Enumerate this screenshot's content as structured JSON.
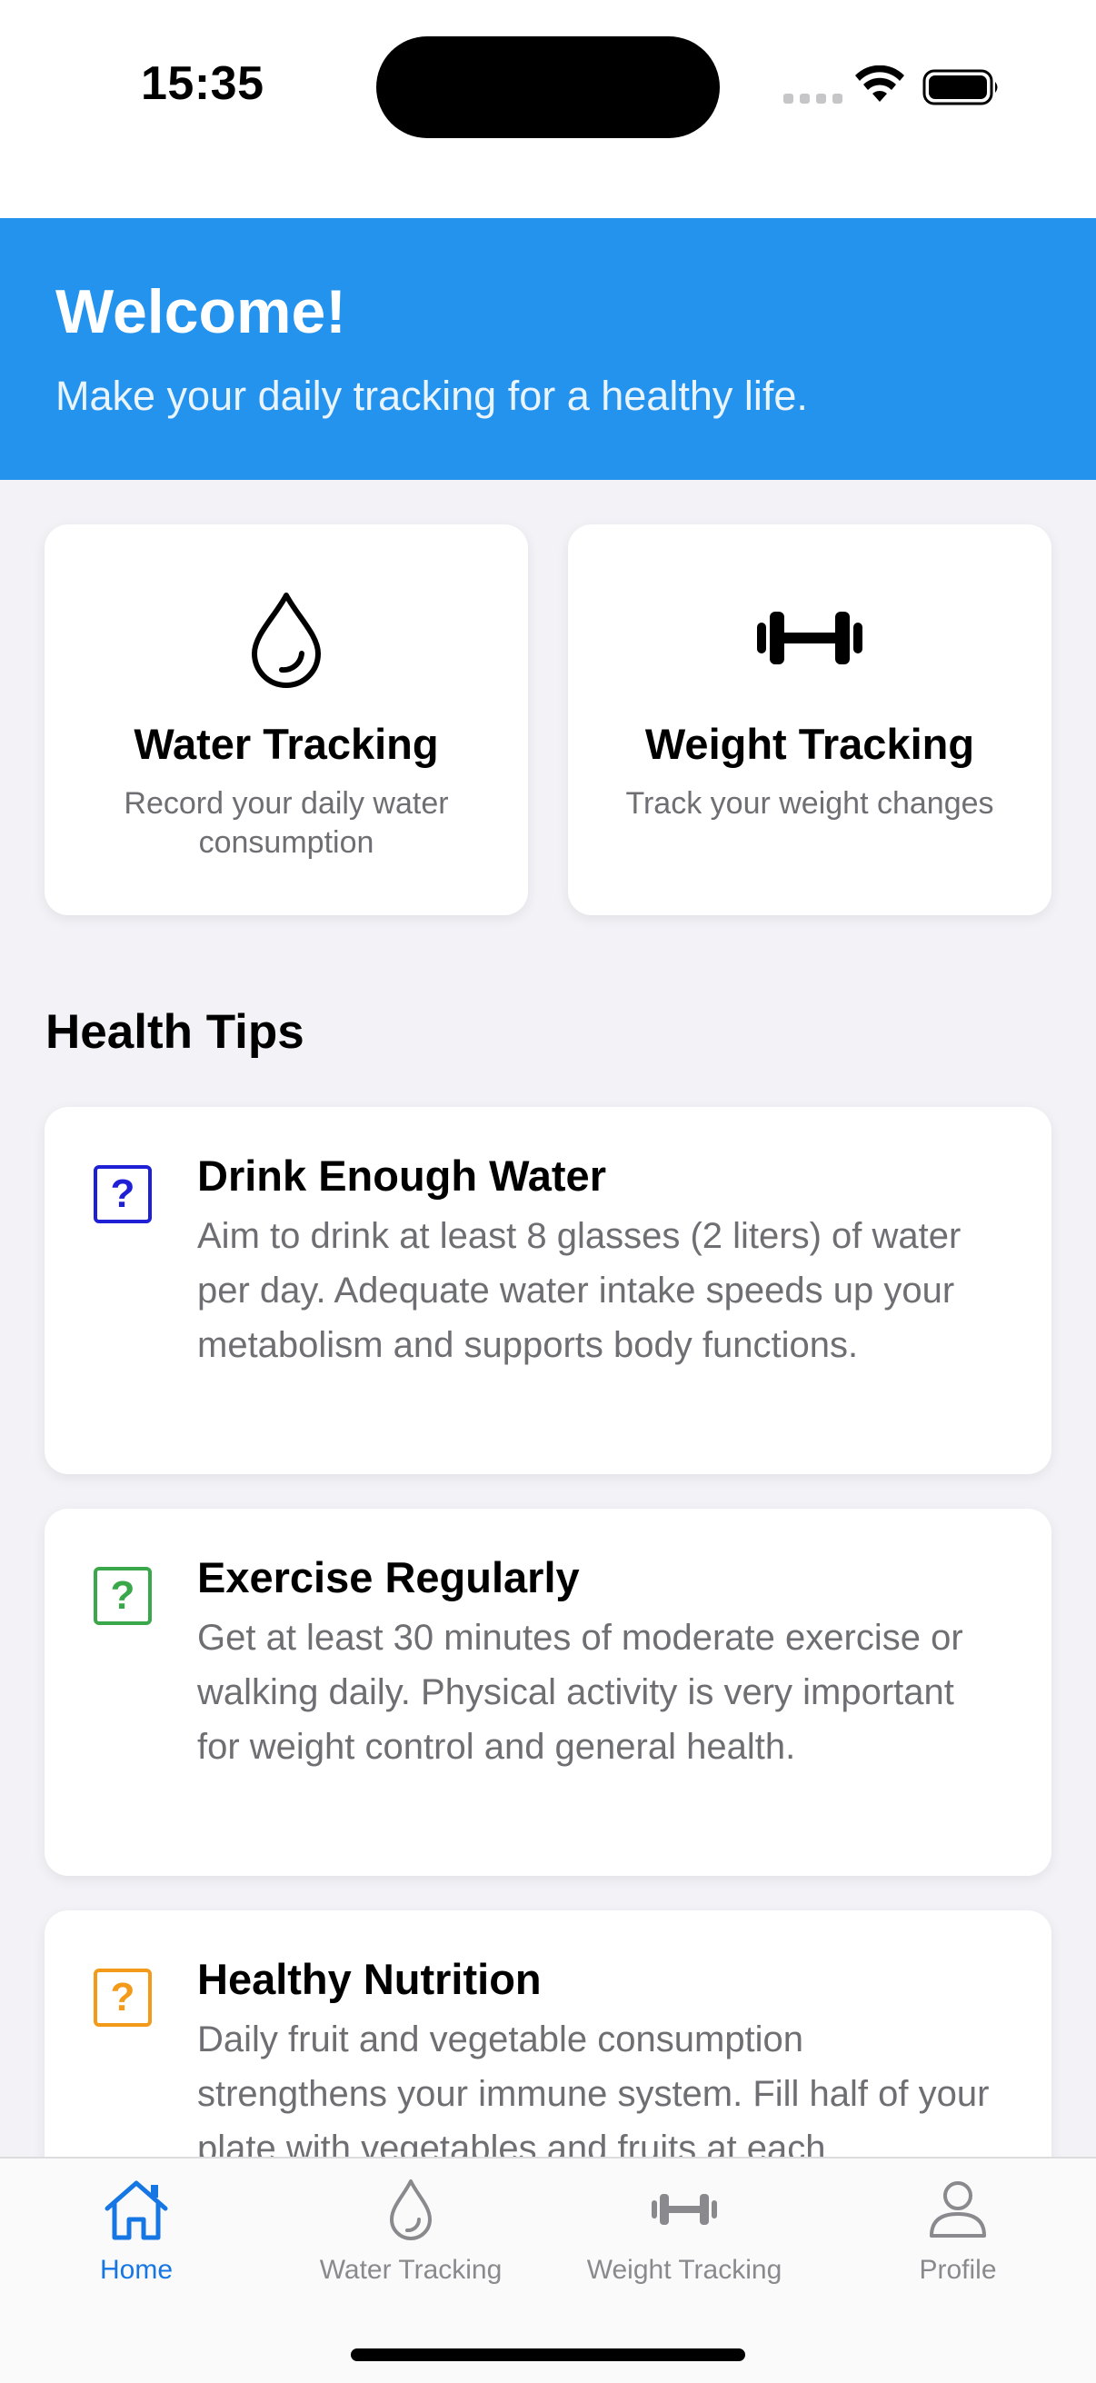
{
  "status_bar": {
    "time": "15:35"
  },
  "header": {
    "title": "Welcome!",
    "subtitle": "Make your daily tracking for a healthy life.",
    "background_color": "#2493ed"
  },
  "features": [
    {
      "icon": "water-drop-icon",
      "title": "Water Tracking",
      "description": "Record your daily water consumption"
    },
    {
      "icon": "dumbbell-icon",
      "title": "Weight Tracking",
      "description": "Track your weight changes"
    }
  ],
  "health_tips": {
    "title": "Health Tips",
    "items": [
      {
        "icon": "question-mark-icon",
        "icon_color": "#1f1fd6",
        "icon_glyph": "?",
        "title": "Drink Enough Water",
        "body": "Aim to drink at least 8 glasses (2 liters) of water per day. Adequate water intake speeds up your metabolism and supports body functions."
      },
      {
        "icon": "question-mark-icon",
        "icon_color": "#3aa84a",
        "icon_glyph": "?",
        "title": "Exercise Regularly",
        "body": "Get at least 30 minutes of moderate exercise or walking daily. Physical activity is very important for weight control and general health."
      },
      {
        "icon": "question-mark-icon",
        "icon_color": "#f39a1a",
        "icon_glyph": "?",
        "title": "Healthy Nutrition",
        "body": "Daily fruit and vegetable consumption strengthens your immune system. Fill half of your plate with vegetables and fruits at each"
      }
    ]
  },
  "tab_bar": {
    "active_color": "#1677e4",
    "inactive_color": "#8a8a8e",
    "tabs": [
      {
        "label": "Home",
        "icon": "home-icon",
        "active": true
      },
      {
        "label": "Water Tracking",
        "icon": "water-drop-icon",
        "active": false
      },
      {
        "label": "Weight Tracking",
        "icon": "dumbbell-icon",
        "active": false
      },
      {
        "label": "Profile",
        "icon": "person-icon",
        "active": false
      }
    ]
  }
}
